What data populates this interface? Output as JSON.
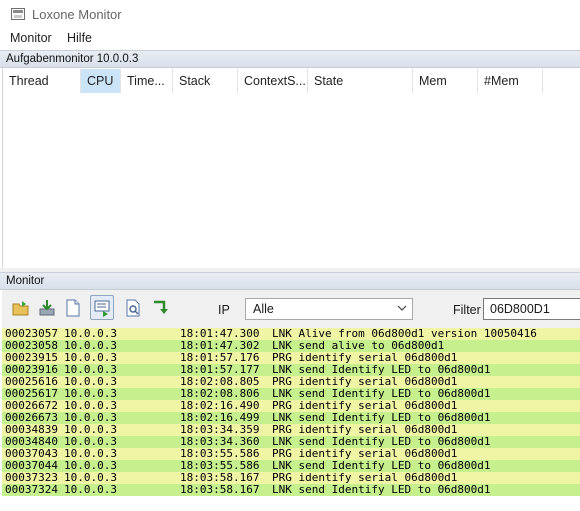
{
  "window": {
    "title": "Loxone Monitor"
  },
  "menu": {
    "items": [
      "Monitor",
      "Hilfe"
    ]
  },
  "task_monitor": {
    "header": "Aufgabenmonitor 10.0.0.3",
    "columns": [
      "Thread",
      "CPU",
      "Time...",
      "Stack",
      "ContextS...",
      "State",
      "Mem",
      "#Mem"
    ],
    "sorted_column": "CPU"
  },
  "monitor": {
    "header": "Monitor",
    "toolbar_icons": [
      "open-folder-icon",
      "download-icon",
      "new-document-icon",
      "monitor-list-icon",
      "search-document-icon",
      "export-arrow-icon"
    ],
    "ip_label": "IP",
    "ip_selected": "Alle",
    "filter_label": "Filter",
    "filter_value": "06D800D1",
    "colors": {
      "row_green": "#c6ef8e",
      "row_yellow": "#f0f5a6"
    },
    "log": [
      {
        "id": "00023057",
        "ip": "10.0.0.3",
        "time": "18:01:47.300",
        "msg": "LNK Alive from 06d800d1 version 10050416",
        "color": "yellow"
      },
      {
        "id": "00023058",
        "ip": "10.0.0.3",
        "time": "18:01:47.302",
        "msg": "LNK send alive to 06d800d1",
        "color": "green"
      },
      {
        "id": "00023915",
        "ip": "10.0.0.3",
        "time": "18:01:57.176",
        "msg": "PRG identify serial 06d800d1",
        "color": "yellow"
      },
      {
        "id": "00023916",
        "ip": "10.0.0.3",
        "time": "18:01:57.177",
        "msg": "LNK send Identify LED to 06d800d1",
        "color": "green"
      },
      {
        "id": "00025616",
        "ip": "10.0.0.3",
        "time": "18:02:08.805",
        "msg": "PRG identify serial 06d800d1",
        "color": "yellow"
      },
      {
        "id": "00025617",
        "ip": "10.0.0.3",
        "time": "18:02:08.806",
        "msg": "LNK send Identify LED to 06d800d1",
        "color": "green"
      },
      {
        "id": "00026672",
        "ip": "10.0.0.3",
        "time": "18:02:16.490",
        "msg": "PRG identify serial 06d800d1",
        "color": "yellow"
      },
      {
        "id": "00026673",
        "ip": "10.0.0.3",
        "time": "18:02:16.499",
        "msg": "LNK send Identify LED to 06d800d1",
        "color": "green"
      },
      {
        "id": "00034839",
        "ip": "10.0.0.3",
        "time": "18:03:34.359",
        "msg": "PRG identify serial 06d800d1",
        "color": "yellow"
      },
      {
        "id": "00034840",
        "ip": "10.0.0.3",
        "time": "18:03:34.360",
        "msg": "LNK send Identify LED to 06d800d1",
        "color": "green"
      },
      {
        "id": "00037043",
        "ip": "10.0.0.3",
        "time": "18:03:55.586",
        "msg": "PRG identify serial 06d800d1",
        "color": "yellow"
      },
      {
        "id": "00037044",
        "ip": "10.0.0.3",
        "time": "18:03:55.586",
        "msg": "LNK send Identify LED to 06d800d1",
        "color": "green"
      },
      {
        "id": "00037323",
        "ip": "10.0.0.3",
        "time": "18:03:58.167",
        "msg": "PRG identify serial 06d800d1",
        "color": "yellow"
      },
      {
        "id": "00037324",
        "ip": "10.0.0.3",
        "time": "18:03:58.167",
        "msg": "LNK send Identify LED to 06d800d1",
        "color": "green"
      }
    ]
  }
}
